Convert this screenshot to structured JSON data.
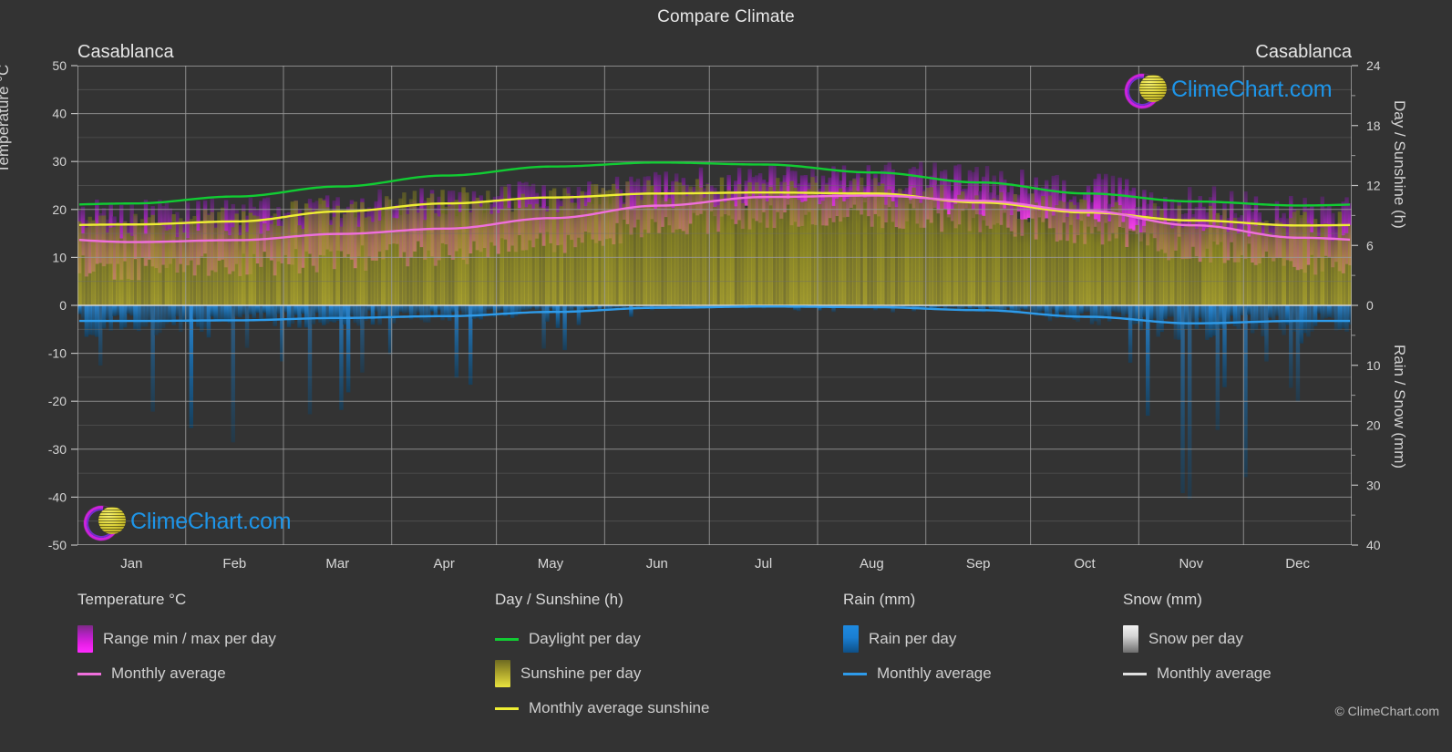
{
  "title": "Compare Climate",
  "city_left": "Casablanca",
  "city_right": "Casablanca",
  "axes": {
    "left_title": "Temperature °C",
    "right_top_title": "Day / Sunshine (h)",
    "right_bottom_title": "Rain / Snow (mm)",
    "left_ticks": [
      "50",
      "40",
      "30",
      "20",
      "10",
      "0",
      "-10",
      "-20",
      "-30",
      "-40",
      "-50"
    ],
    "right_top_ticks": [
      "24",
      "18",
      "12",
      "6",
      "0"
    ],
    "right_bottom_ticks": [
      "0",
      "10",
      "20",
      "30",
      "40"
    ],
    "months": [
      "Jan",
      "Feb",
      "Mar",
      "Apr",
      "May",
      "Jun",
      "Jul",
      "Aug",
      "Sep",
      "Oct",
      "Nov",
      "Dec"
    ]
  },
  "logo": {
    "text": "ClimeChart.com",
    "mark": "climechart-globe-icon"
  },
  "legend": {
    "temperature": {
      "heading": "Temperature °C",
      "items": [
        {
          "label": "Range min / max per day",
          "marker": "gradient-swatch",
          "color": "#e81fe8"
        },
        {
          "label": "Monthly average",
          "marker": "line-swatch",
          "color": "#ef6fdc"
        }
      ]
    },
    "daysun": {
      "heading": "Day / Sunshine (h)",
      "items": [
        {
          "label": "Daylight per day",
          "marker": "line-swatch",
          "color": "#11cc33"
        },
        {
          "label": "Sunshine per day",
          "marker": "gradient-swatch",
          "color": "#e9e33f"
        },
        {
          "label": "Monthly average sunshine",
          "marker": "line-swatch",
          "color": "#eeee33"
        }
      ]
    },
    "rain": {
      "heading": "Rain (mm)",
      "items": [
        {
          "label": "Rain per day",
          "marker": "gradient-swatch",
          "color": "#1e8ae0"
        },
        {
          "label": "Monthly average",
          "marker": "line-swatch",
          "color": "#2e9bea"
        }
      ]
    },
    "snow": {
      "heading": "Snow (mm)",
      "items": [
        {
          "label": "Snow per day",
          "marker": "gradient-swatch",
          "color": "#e8e8e8"
        },
        {
          "label": "Monthly average",
          "marker": "line-swatch",
          "color": "#e0e0e0"
        }
      ]
    }
  },
  "copyright": "© ClimeChart.com",
  "colors": {
    "background": "#333333",
    "grid": "#8c8c8c",
    "text": "#d6d6d6",
    "daylight": "#11cc33",
    "sunshine_line": "#eeee33",
    "temp_avg": "#ef6fdc",
    "rain_avg": "#2e9bea",
    "temp_band": "#c92fd0",
    "sunshine_band": "#a8a02b",
    "rain_band": "#1e6fae"
  },
  "chart_data": {
    "type": "line",
    "title": "Compare Climate",
    "subtitle": "Casablanca",
    "xlabel": "",
    "ylabel": "Temperature °C",
    "ylim": [
      -50,
      50
    ],
    "y2_top_label": "Day / Sunshine (h)",
    "y2_top_lim": [
      0,
      24
    ],
    "y2_bottom_label": "Rain / Snow (mm)",
    "y2_bottom_lim": [
      0,
      40
    ],
    "grid": true,
    "legend_position": "below-plot",
    "categories": [
      "Jan",
      "Feb",
      "Mar",
      "Apr",
      "May",
      "Jun",
      "Jul",
      "Aug",
      "Sep",
      "Oct",
      "Nov",
      "Dec"
    ],
    "series": [
      {
        "name": "Daylight per day",
        "unit": "h",
        "axis": "right-top",
        "color": "#11cc33",
        "values": [
          10.2,
          10.9,
          11.9,
          13.0,
          13.9,
          14.3,
          14.1,
          13.3,
          12.3,
          11.2,
          10.4,
          10.0
        ]
      },
      {
        "name": "Monthly average sunshine",
        "unit": "h",
        "axis": "right-top",
        "color": "#eeee33",
        "values": [
          8.1,
          8.4,
          9.4,
          10.2,
          10.8,
          11.2,
          11.3,
          11.2,
          10.3,
          9.3,
          8.5,
          8.0
        ]
      },
      {
        "name": "Temperature monthly average",
        "unit": "°C",
        "axis": "left",
        "color": "#ef6fdc",
        "values": [
          13.2,
          13.6,
          14.9,
          16.0,
          18.2,
          20.8,
          22.6,
          22.9,
          21.8,
          19.7,
          16.7,
          14.1
        ]
      },
      {
        "name": "Rain monthly average",
        "unit": "mm",
        "axis": "right-bottom",
        "color": "#2e9bea",
        "values": [
          2.6,
          2.5,
          2.1,
          1.8,
          1.1,
          0.4,
          0.2,
          0.3,
          0.8,
          1.9,
          3.0,
          2.6
        ]
      }
    ],
    "bands": [
      {
        "name": "Range min / max per day (Temperature)",
        "unit": "°C",
        "axis": "left",
        "color": "#c92fd0",
        "min": [
          8.0,
          8.4,
          9.8,
          11.0,
          13.4,
          16.4,
          18.4,
          18.8,
          17.6,
          15.0,
          11.6,
          9.2
        ],
        "max": [
          19.0,
          19.5,
          20.8,
          21.4,
          23.0,
          25.2,
          26.8,
          27.2,
          26.4,
          24.6,
          21.8,
          19.6
        ]
      },
      {
        "name": "Sunshine per day",
        "unit": "h",
        "axis": "right-top",
        "color": "#a8a02b",
        "min": [
          0,
          0,
          0,
          0,
          0,
          0,
          0,
          0,
          0,
          0,
          0,
          0
        ],
        "max": [
          8.1,
          8.4,
          9.4,
          10.2,
          10.8,
          11.2,
          11.3,
          11.2,
          10.3,
          9.3,
          8.5,
          8.0
        ]
      },
      {
        "name": "Rain per day",
        "unit": "mm",
        "axis": "right-bottom",
        "color": "#1e6fae",
        "min": [
          0,
          0,
          0,
          0,
          0,
          0,
          0,
          0,
          0,
          0,
          0,
          0
        ],
        "max": [
          22,
          18,
          15,
          12,
          6,
          2,
          1,
          1,
          5,
          14,
          26,
          22
        ]
      },
      {
        "name": "Snow per day",
        "unit": "mm",
        "axis": "right-bottom",
        "color": "#e8e8e8",
        "min": [
          0,
          0,
          0,
          0,
          0,
          0,
          0,
          0,
          0,
          0,
          0,
          0
        ],
        "max": [
          0,
          0,
          0,
          0,
          0,
          0,
          0,
          0,
          0,
          0,
          0,
          0
        ]
      }
    ]
  }
}
